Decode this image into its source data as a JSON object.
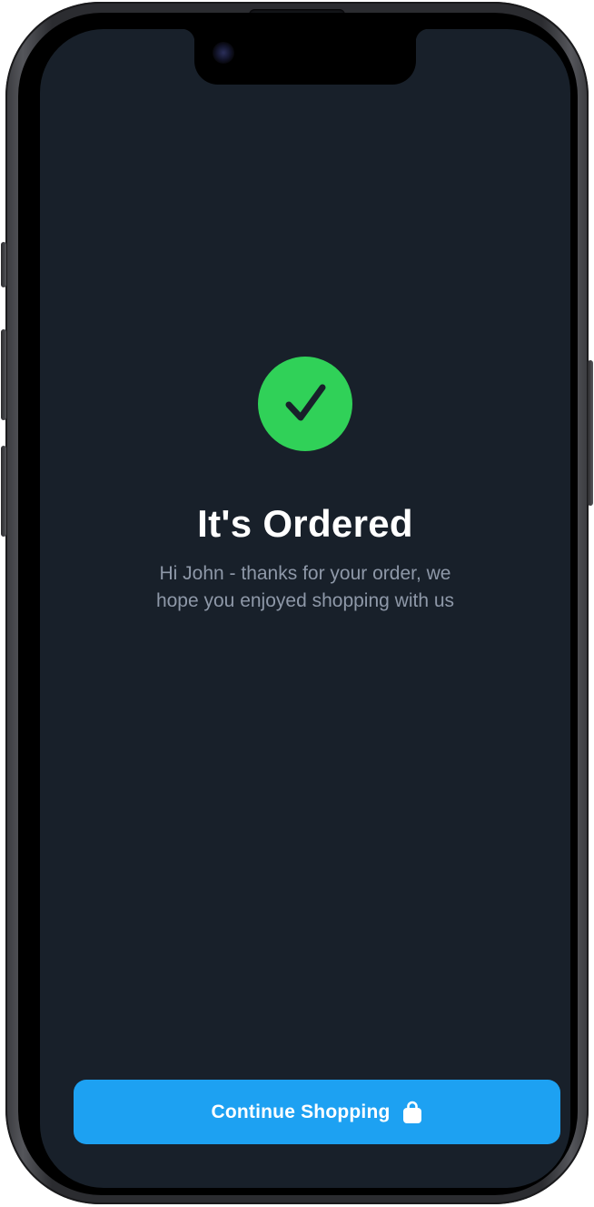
{
  "confirmation": {
    "title": "It's Ordered",
    "message": "Hi John - thanks for your order, we hope you enjoyed shopping with us",
    "status_icon": "checkmark-icon",
    "status_color": "#30d158"
  },
  "actions": {
    "continue_label": "Continue Shopping",
    "continue_icon": "shopping-bag-icon",
    "accent_color": "#1da1f2"
  },
  "theme": {
    "background": "#18202a",
    "message_color": "#8e98a8"
  }
}
